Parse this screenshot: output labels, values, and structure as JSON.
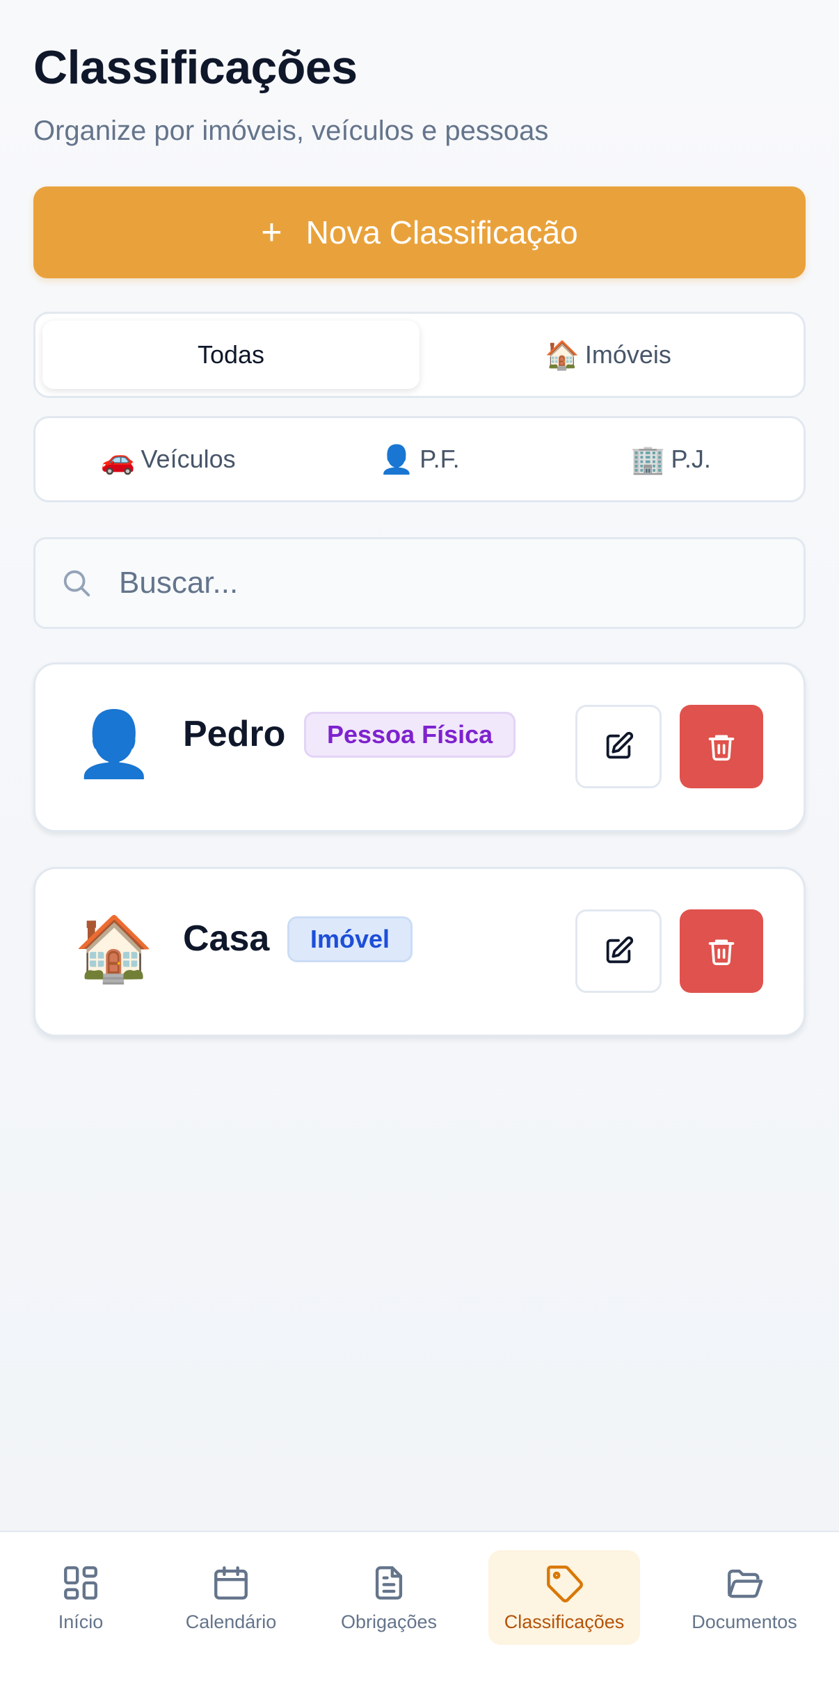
{
  "header": {
    "title": "Classificações",
    "subtitle": "Organize por imóveis, veículos e pessoas"
  },
  "new_button": {
    "icon": "plus-icon",
    "label": "Nova Classificação"
  },
  "filters": {
    "row1": [
      {
        "label": "Todas",
        "emoji": "",
        "active": true
      },
      {
        "label": "Imóveis",
        "emoji": "🏠",
        "active": false
      }
    ],
    "row2": [
      {
        "label": "Veículos",
        "emoji": "🚗",
        "active": false
      },
      {
        "label": "P.F.",
        "emoji": "👤",
        "active": false
      },
      {
        "label": "P.J.",
        "emoji": "🏢",
        "active": false
      }
    ]
  },
  "search": {
    "placeholder": "Buscar...",
    "value": ""
  },
  "items": [
    {
      "emoji": "👤",
      "name": "Pedro",
      "type": "Pessoa Física"
    },
    {
      "emoji": "🏠",
      "name": "Casa",
      "type": "Imóvel"
    }
  ],
  "bottom_nav": [
    {
      "label": "Início",
      "icon": "dashboard-icon",
      "active": false
    },
    {
      "label": "Calendário",
      "icon": "calendar-icon",
      "active": false
    },
    {
      "label": "Obrigações",
      "icon": "document-icon",
      "active": false
    },
    {
      "label": "Classificações",
      "icon": "tag-icon",
      "active": true
    },
    {
      "label": "Documentos",
      "icon": "folder-open-icon",
      "active": false
    }
  ],
  "colors": {
    "accent": "#e9a23b",
    "danger": "#e0524d",
    "active_nav_text": "#b45309",
    "active_nav_bg": "#fdf4e1",
    "badge_pf": "#7e22ce",
    "badge_imovel": "#1d4ed8"
  }
}
